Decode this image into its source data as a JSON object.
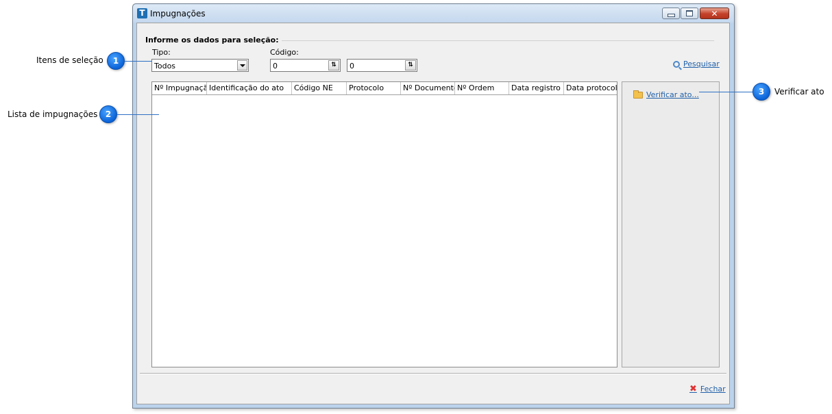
{
  "window": {
    "title": "Impugnações",
    "app_icon_letter": "T",
    "close_glyph": "✕"
  },
  "filters": {
    "group_title": "Informe os dados para seleção:",
    "tipo_label": "Tipo:",
    "tipo_value": "Todos",
    "codigo_label": "Código:",
    "codigo_from": "0",
    "codigo_to": "0",
    "search_button": "Pesquisar"
  },
  "grid": {
    "columns": [
      "Nº Impugnação",
      "Identificação do ato",
      "Código NE",
      "Protocolo",
      "Nº Documento",
      "Nº Ordem",
      "Data registro",
      "Data protocolo"
    ],
    "rows": []
  },
  "side_panel": {
    "verify_button": "Verificar ato..."
  },
  "footer": {
    "close_button": "Fechar"
  },
  "callouts": [
    {
      "number": "1",
      "label": "Itens de seleção"
    },
    {
      "number": "2",
      "label": "Lista de impugnações"
    },
    {
      "number": "3",
      "label": "Verificar ato"
    }
  ],
  "colors": {
    "callout_badge": "#1a7be8",
    "link": "#1f5fa8",
    "close_icon": "#d33333"
  },
  "icons": {
    "search": "magnifier-icon",
    "verify": "folder-open-icon",
    "close": "red-x-icon"
  }
}
